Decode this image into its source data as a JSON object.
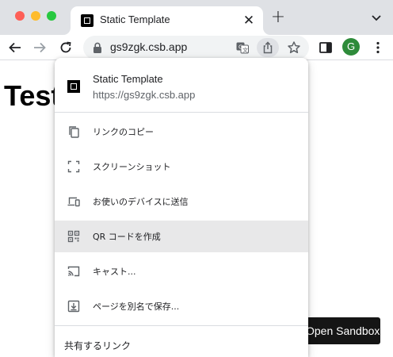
{
  "browser": {
    "tab": {
      "title": "Static Template",
      "close_glyph": "✕",
      "favicon": "codesandbox-favicon-icon"
    },
    "new_tab_glyph": "+",
    "omnibox": {
      "url": "gs9zgk.csb.app"
    },
    "avatar_letter": "G"
  },
  "page": {
    "heading": "Test",
    "sandbox_button": "Open Sandbox"
  },
  "share_menu": {
    "page_title": "Static Template",
    "page_url": "https://gs9zgk.csb.app",
    "items": [
      {
        "label": "リンクのコピー",
        "icon": "copy-icon"
      },
      {
        "label": "スクリーンショット",
        "icon": "screenshot-icon"
      },
      {
        "label": "お使いのデバイスに送信",
        "icon": "devices-icon"
      },
      {
        "label": "QR コードを作成",
        "icon": "qr-code-icon",
        "highlighted": true
      },
      {
        "label": "キャスト...",
        "icon": "cast-icon"
      },
      {
        "label": "ページを別名で保存...",
        "icon": "save-page-icon"
      }
    ],
    "section_title": "共有するリンク"
  },
  "colors": {
    "tabstrip_bg": "#dfe1e5",
    "highlight_bg": "#e8e8e9",
    "avatar_bg": "#2e8b3a",
    "sandbox_button_bg": "#151515"
  }
}
